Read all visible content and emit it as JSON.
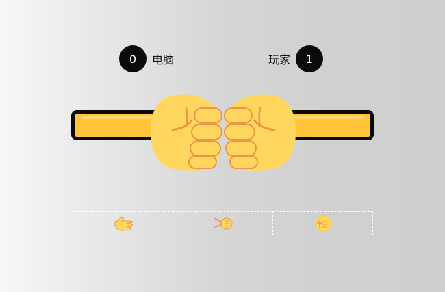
{
  "scoreboard": {
    "computer": {
      "score": "0",
      "label": "电脑"
    },
    "player": {
      "score": "1",
      "label": "玩家"
    }
  },
  "arena": {
    "computer_hand": "rock-fist-icon",
    "player_hand": "rock-fist-icon",
    "colors": {
      "skin": "#ffd75e",
      "skin_shadow": "#ffca38",
      "crease": "#ee9446",
      "bar_fill": "#ffc43a",
      "bar_outline": "#0a0a0a"
    }
  },
  "choices": [
    {
      "name": "paper",
      "icon": "paper-hand-icon"
    },
    {
      "name": "scissors",
      "icon": "scissors-hand-icon"
    },
    {
      "name": "rock",
      "icon": "rock-hand-icon"
    }
  ]
}
